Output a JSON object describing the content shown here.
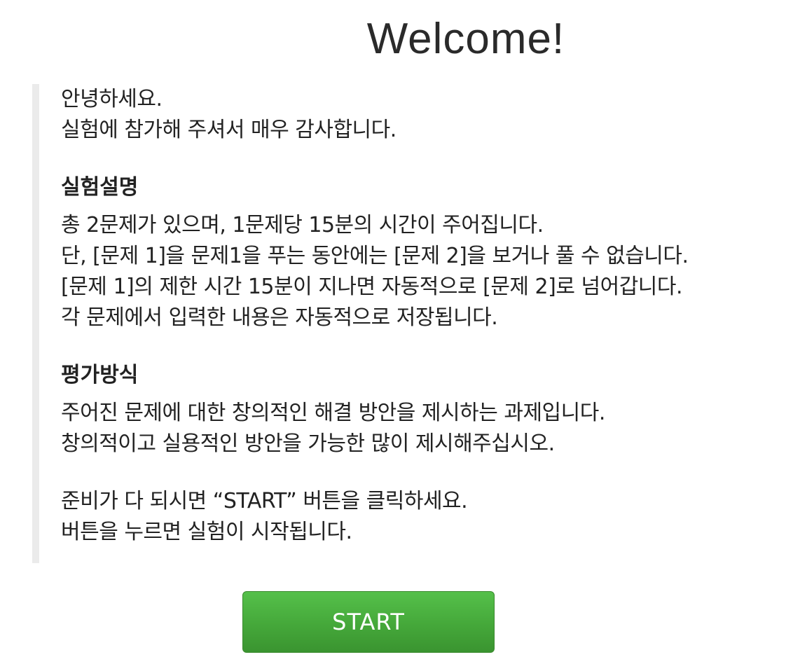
{
  "title": "Welcome!",
  "greeting": [
    "안녕하세요.",
    "실험에 참가해 주셔서 매우 감사합니다."
  ],
  "sections": [
    {
      "heading": "실험설명",
      "lines": [
        "총 2문제가 있으며, 1문제당 15분의 시간이 주어집니다.",
        "단, [문제 1]을 문제1을 푸는 동안에는 [문제 2]을 보거나 풀 수 없습니다.",
        "[문제 1]의 제한 시간 15분이 지나면 자동적으로 [문제 2]로 넘어갑니다.",
        "각 문제에서 입력한 내용은 자동적으로 저장됩니다."
      ]
    },
    {
      "heading": "평가방식",
      "lines": [
        "주어진 문제에 대한 창의적인 해결 방안을 제시하는 과제입니다.",
        "창의적이고 실용적인 방안을 가능한 많이 제시해주십시오."
      ]
    }
  ],
  "closing": [
    "준비가 다 되시면 “START” 버튼을 클릭하세요.",
    "버튼을 누르면 실험이 시작됩니다."
  ],
  "start_button": {
    "label": "START",
    "color": "#4caf3f"
  }
}
